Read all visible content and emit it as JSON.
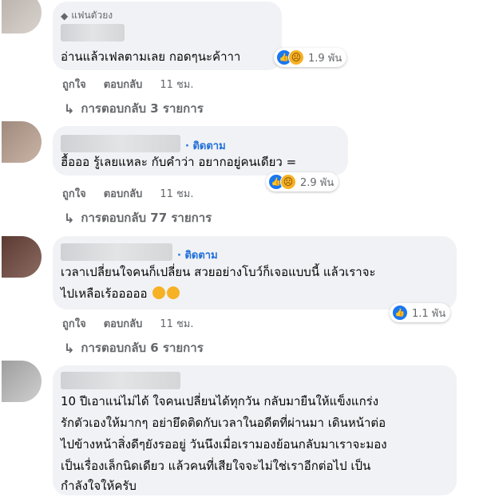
{
  "comments": [
    {
      "badge": "แฟนตัวยง",
      "text_lines": [
        "อ่านแล้วเฟลตามเลย กอดๆนะค้าาา"
      ],
      "reaction_count": "1.9 พัน",
      "like_label": "ถูกใจ",
      "reply_label": "ตอบกลับ",
      "time": "11 ชม.",
      "replies_label": "การตอบกลับ 3 รายการ"
    },
    {
      "follow": "· ติดตาม",
      "text_lines": [
        "ฮื้อออ รู้เลยแหละ กับคำว่า อยากอยู่คนเดียว ="
      ],
      "reaction_count": "2.9 พัน",
      "like_label": "ถูกใจ",
      "reply_label": "ตอบกลับ",
      "time": "11 ชม.",
      "replies_label": "การตอบกลับ 77 รายการ"
    },
    {
      "follow": "· ติดตาม",
      "text_lines": [
        "เวลาเปลี่ยนใจคนก็เปลี่ยน สวยอย่างโบว์ก็เจอแบบนี้ แล้วเราจะ",
        "ไปเหลือเร้อออออ"
      ],
      "reaction_count": "1.1 พัน",
      "like_label": "ถูกใจ",
      "reply_label": "ตอบกลับ",
      "time": "11 ชม.",
      "replies_label": "การตอบกลับ 6 รายการ"
    },
    {
      "text_lines": [
        "10 ปีเอาแน่ไม่ได้ ใจคนเปลี่ยนได้ทุกวัน กลับมายืนให้แข็งแกร่ง",
        "รักตัวเองให้มากๆ อย่ายึดติดกับเวลาในอดีตที่ผ่านมา เดินหน้าต่อ",
        "ไปข้างหน้าสิ่งดีๆยังรออยู่ วันนึงเมื่อเรามองย้อนกลับมาเราจะมอง",
        "เป็นเรื่องเล็กนิดเดียว แล้วคนที่เสียใจจะไม่ใช่เราอีกต่อไป เป็น",
        "กำลังใจให้ครับ"
      ]
    }
  ]
}
